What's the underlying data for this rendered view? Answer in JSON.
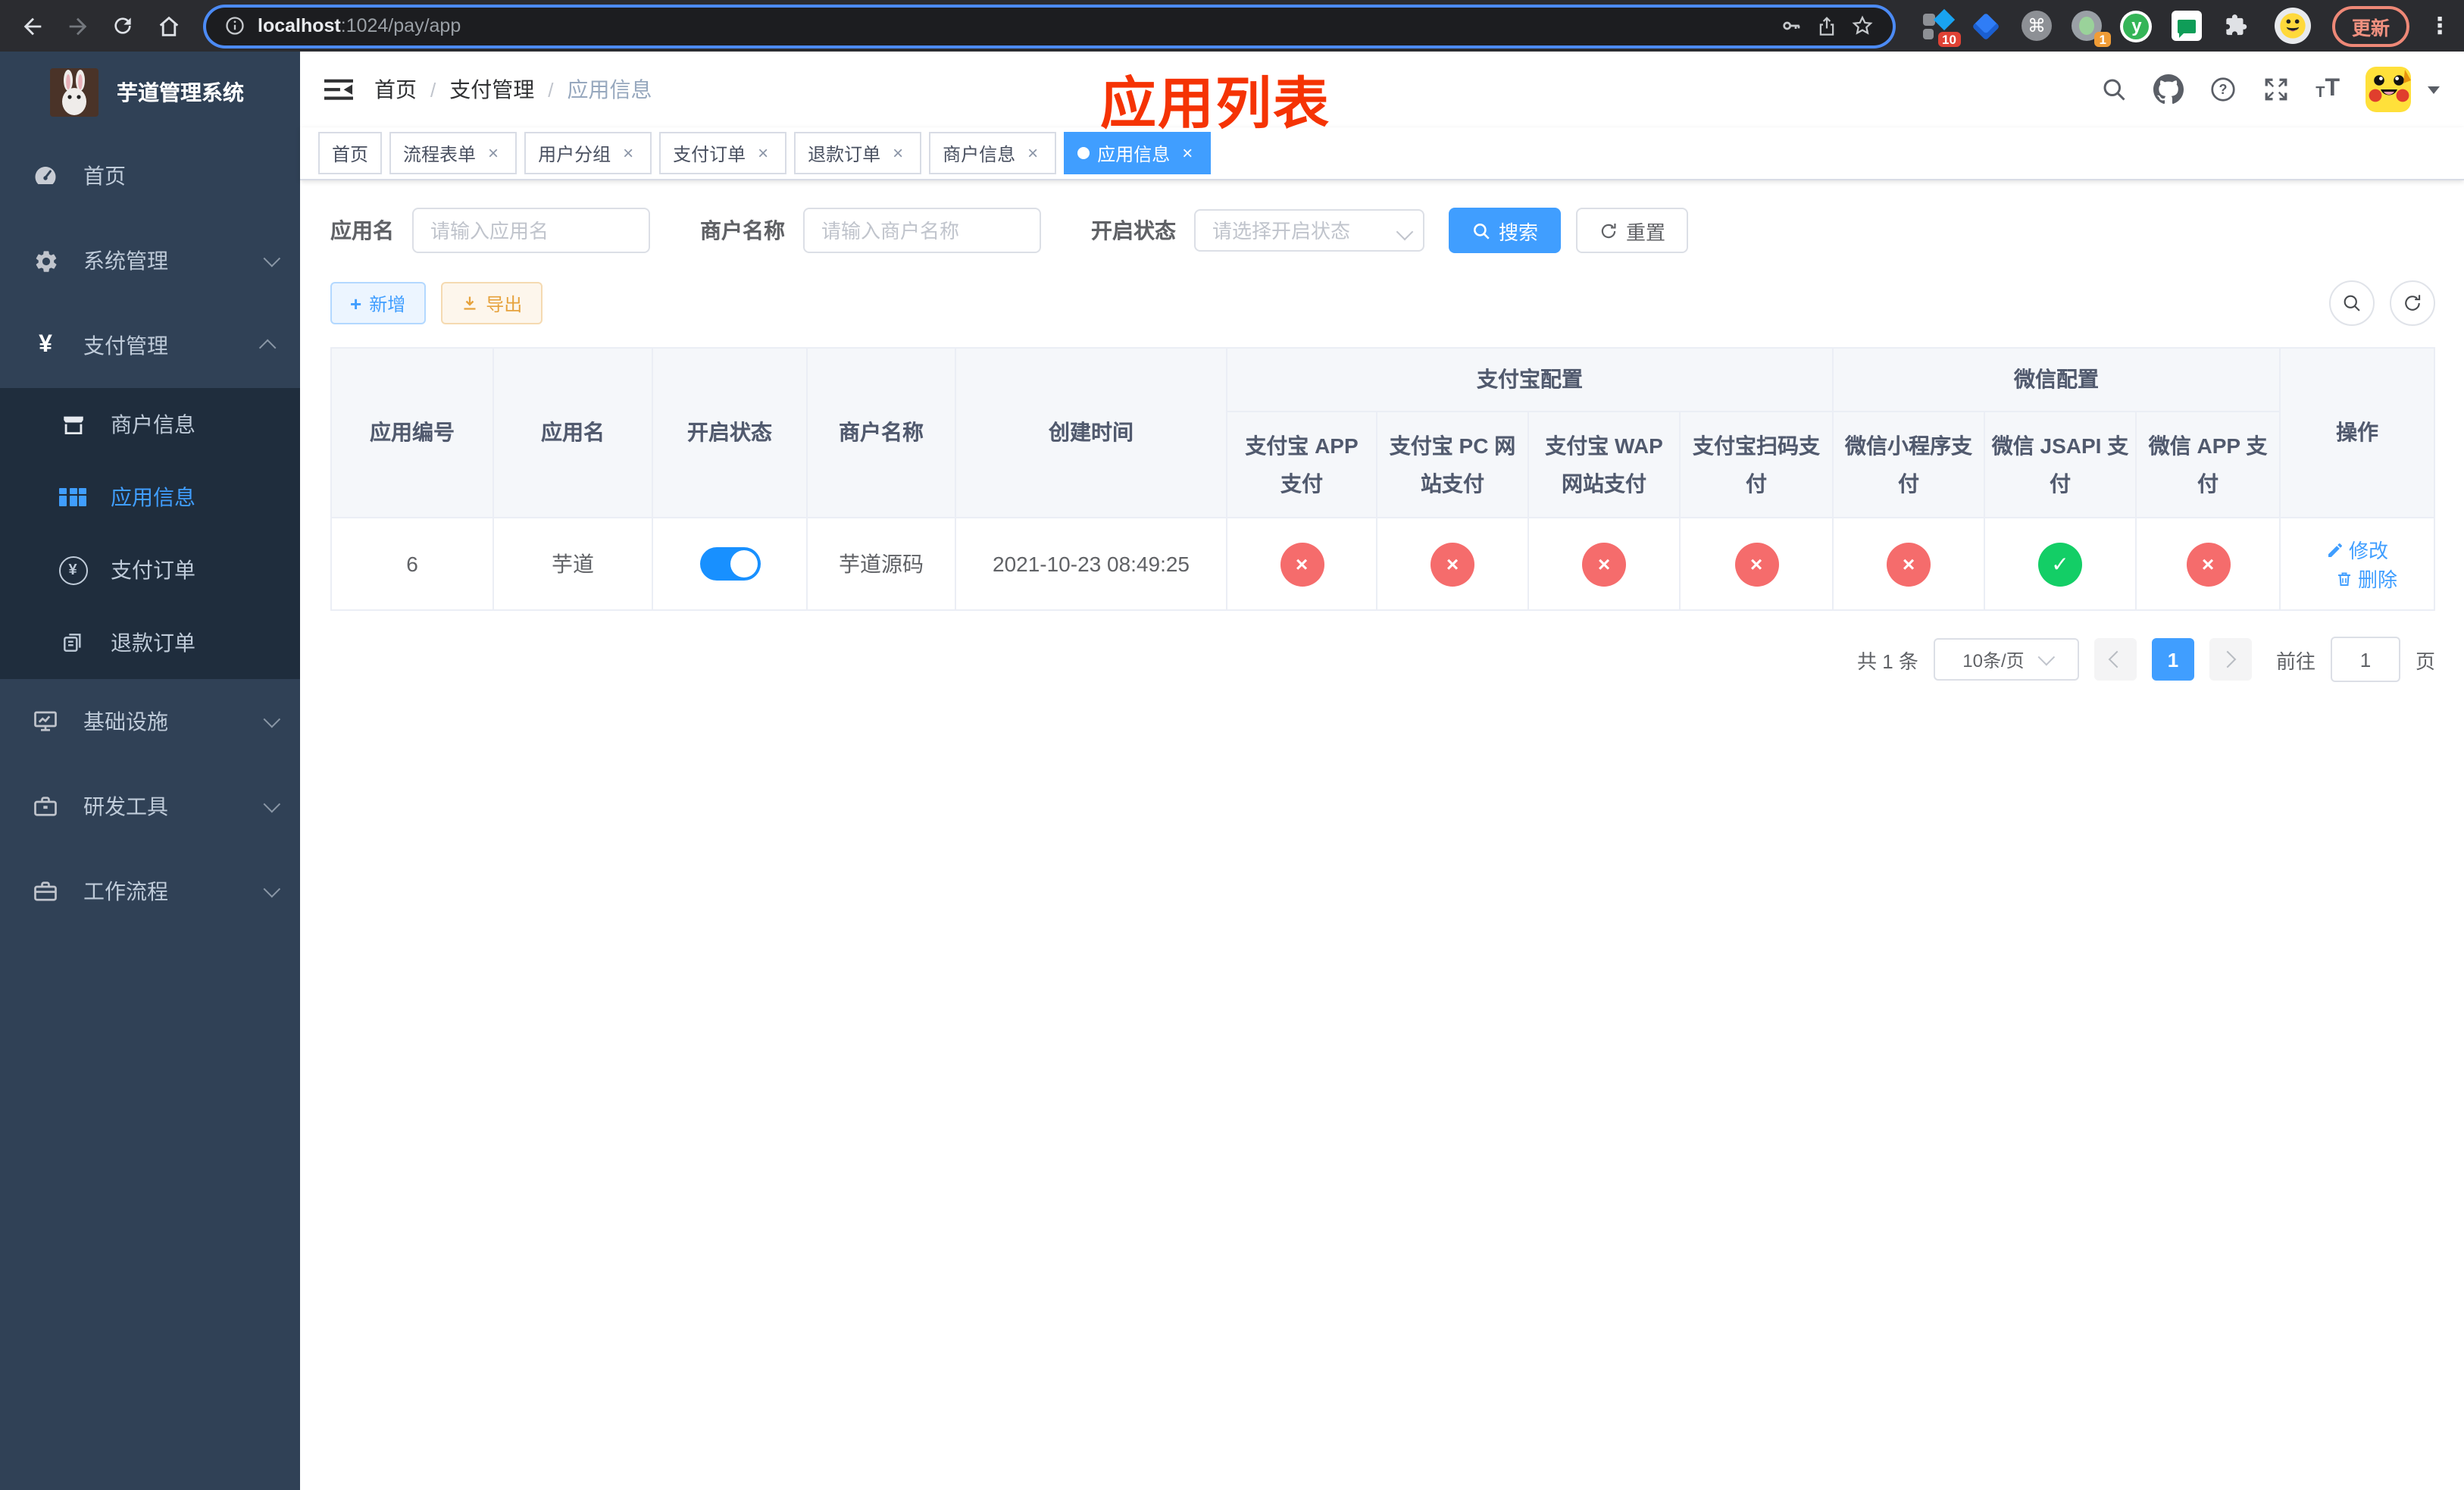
{
  "browser": {
    "url_host": "localhost",
    "url_path": ":1024/pay/app",
    "ext_badge_red": "10",
    "ext_badge_orange": "1",
    "update_label": "更新"
  },
  "icons": {
    "yen": "¥",
    "close": "×",
    "dots": "⋮",
    "cmd": "⌘",
    "yuque": "y",
    "slash": "/",
    "plus": "+",
    "question": "?",
    "font_size": "T"
  },
  "sidebar": {
    "title": "芋道管理系统",
    "items": {
      "home": "首页",
      "system": "系统管理",
      "pay": "支付管理",
      "merchant": "商户信息",
      "app": "应用信息",
      "pay_order": "支付订单",
      "refund_order": "退款订单",
      "infra": "基础设施",
      "dev_tools": "研发工具",
      "workflow": "工作流程"
    }
  },
  "navbar": {
    "breadcrumb": [
      "首页",
      "支付管理",
      "应用信息"
    ],
    "annotation": "应用列表"
  },
  "tabs": [
    {
      "label": "首页"
    },
    {
      "label": "流程表单"
    },
    {
      "label": "用户分组"
    },
    {
      "label": "支付订单"
    },
    {
      "label": "退款订单"
    },
    {
      "label": "商户信息"
    },
    {
      "label": "应用信息"
    }
  ],
  "filters": {
    "app_name_label": "应用名",
    "app_name_placeholder": "请输入应用名",
    "merchant_label": "商户名称",
    "merchant_placeholder": "请输入商户名称",
    "status_label": "开启状态",
    "status_placeholder": "请选择开启状态",
    "search_label": "搜索",
    "reset_label": "重置"
  },
  "toolbar": {
    "add_label": "新增",
    "export_label": "导出"
  },
  "table": {
    "headers": {
      "app_id": "应用编号",
      "app_name": "应用名",
      "open_status": "开启状态",
      "merchant_name": "商户名称",
      "create_time": "创建时间",
      "alipay_group": "支付宝配置",
      "wechat_group": "微信配置",
      "alipay_app": "支付宝 APP 支付",
      "alipay_pc": "支付宝 PC 网站支付",
      "alipay_wap": "支付宝 WAP 网站支付",
      "alipay_qr": "支付宝扫码支付",
      "wx_lite": "微信小程序支付",
      "wx_jsapi": "微信 JSAPI 支付",
      "wx_app": "微信 APP 支付",
      "actions": "操作"
    },
    "row": {
      "id": "6",
      "name": "芋道",
      "merchant": "芋道源码",
      "create_time": "2021-10-23 08:49:25",
      "channels": [
        "×",
        "×",
        "×",
        "×",
        "×",
        "✓",
        "×"
      ],
      "edit_label": "修改",
      "delete_label": "删除"
    }
  },
  "pagination": {
    "total": "共 1 条",
    "page_size": "10条/页",
    "page": "1",
    "goto_label": "前往",
    "goto_value": "1",
    "page_unit": "页"
  },
  "colors": {
    "primary": "#409eff",
    "switch_on": "#1890ff",
    "channel_off": "#f56c6c",
    "channel_on": "#13ce66",
    "annotation": "#f53304",
    "sidebar_bg": "#304156",
    "submenu_bg": "#1f2d3d"
  }
}
